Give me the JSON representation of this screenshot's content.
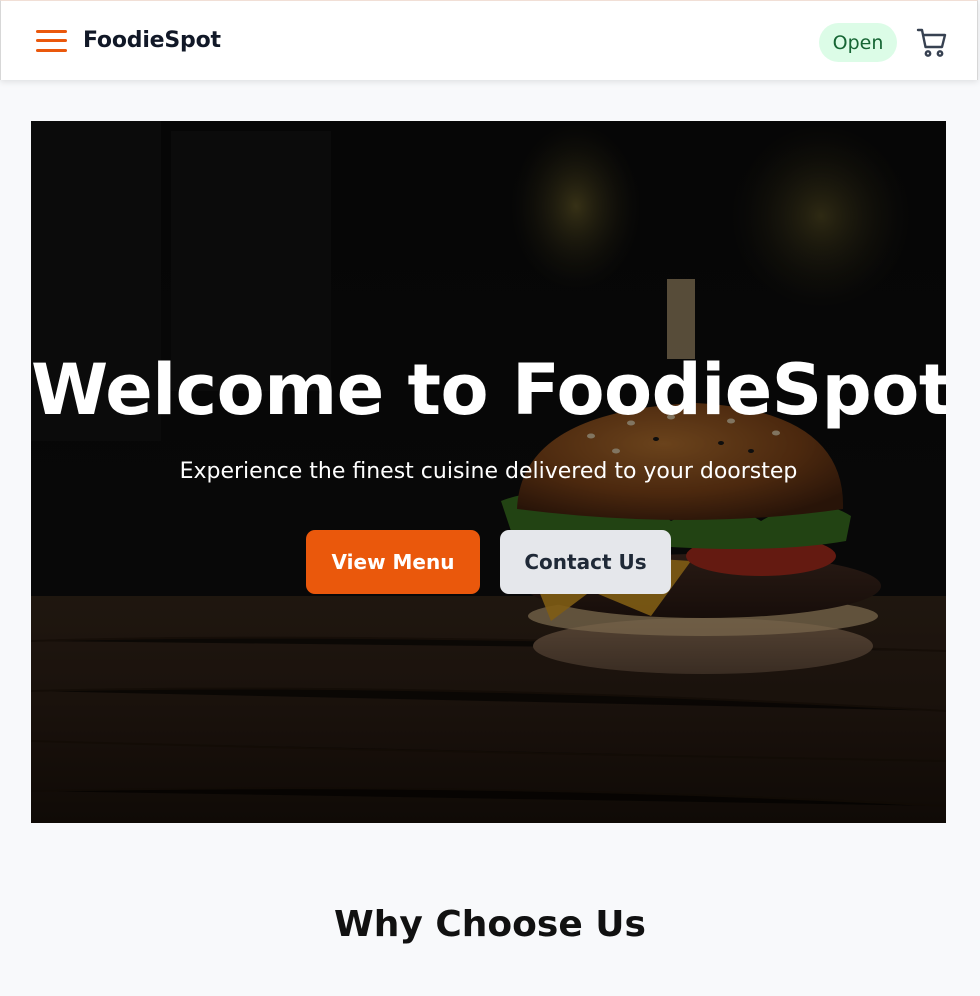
{
  "header": {
    "brand": "FoodieSpot",
    "status": "Open",
    "menu_icon": "hamburger-menu-icon",
    "cart_icon": "shopping-cart-icon"
  },
  "hero": {
    "title": "Welcome to FoodieSpot",
    "subtitle": "Experience the finest cuisine delivered to your doorstep",
    "primary_button": "View Menu",
    "secondary_button": "Contact Us",
    "background_image": "burger-on-wooden-table"
  },
  "section": {
    "title": "Why Choose Us"
  },
  "colors": {
    "accent": "#ea580c",
    "status_bg": "#dcfce7",
    "status_text": "#166534",
    "secondary_button_bg": "#e5e7eb",
    "page_bg": "#f8f9fb"
  }
}
